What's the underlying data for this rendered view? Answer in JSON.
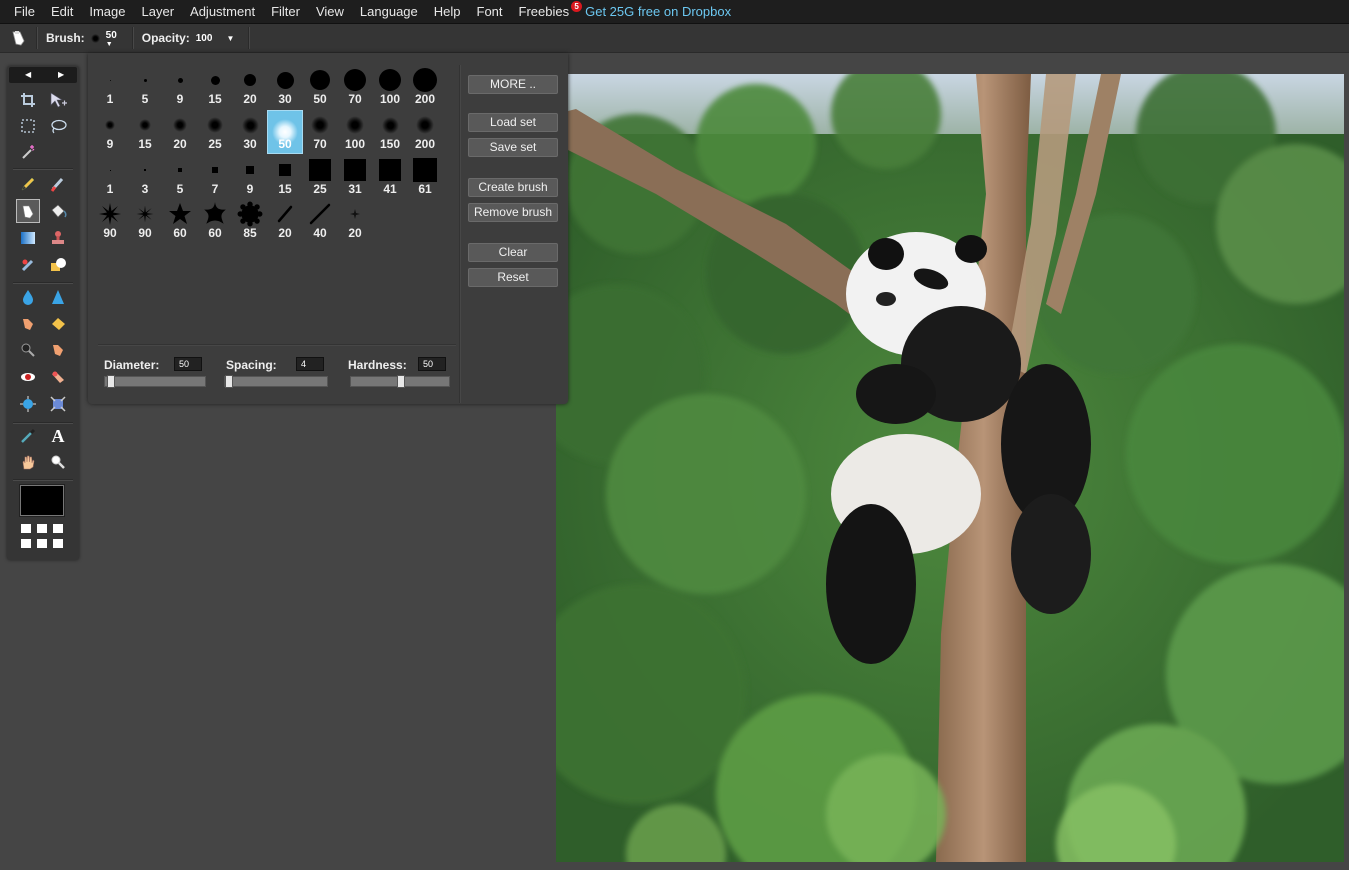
{
  "menu": {
    "items": [
      {
        "label": "File"
      },
      {
        "label": "Edit"
      },
      {
        "label": "Image"
      },
      {
        "label": "Layer"
      },
      {
        "label": "Adjustment"
      },
      {
        "label": "Filter"
      },
      {
        "label": "View"
      },
      {
        "label": "Language"
      },
      {
        "label": "Help"
      },
      {
        "label": "Font"
      },
      {
        "label": "Freebies",
        "badge": "5"
      }
    ],
    "promo": "Get 25G free on Dropbox"
  },
  "options": {
    "brush_label": "Brush:",
    "brush_size": "50",
    "opacity_label": "Opacity:",
    "opacity_value": "100"
  },
  "brush_panel": {
    "rows": [
      {
        "type": "round-hard",
        "items": [
          {
            "label": "1"
          },
          {
            "label": "5"
          },
          {
            "label": "9"
          },
          {
            "label": "15"
          },
          {
            "label": "20"
          },
          {
            "label": "30"
          },
          {
            "label": "50"
          },
          {
            "label": "70"
          },
          {
            "label": "100"
          },
          {
            "label": "200"
          }
        ]
      },
      {
        "type": "round-soft",
        "items": [
          {
            "label": "9"
          },
          {
            "label": "15"
          },
          {
            "label": "20"
          },
          {
            "label": "25"
          },
          {
            "label": "30"
          },
          {
            "label": "50",
            "selected": true
          },
          {
            "label": "70"
          },
          {
            "label": "100"
          },
          {
            "label": "150"
          },
          {
            "label": "200"
          }
        ]
      },
      {
        "type": "square",
        "items": [
          {
            "label": "1"
          },
          {
            "label": "3"
          },
          {
            "label": "5"
          },
          {
            "label": "7"
          },
          {
            "label": "9"
          },
          {
            "label": "15"
          },
          {
            "label": "25"
          },
          {
            "label": "31"
          },
          {
            "label": "41"
          },
          {
            "label": "61"
          }
        ]
      },
      {
        "type": "shape",
        "items": [
          {
            "label": "90"
          },
          {
            "label": "90"
          },
          {
            "label": "60"
          },
          {
            "label": "60"
          },
          {
            "label": "85"
          },
          {
            "label": "20"
          },
          {
            "label": "40"
          },
          {
            "label": "20"
          }
        ]
      }
    ],
    "buttons": {
      "more": "MORE ..",
      "load_set": "Load set",
      "save_set": "Save set",
      "create_brush": "Create brush",
      "remove_brush": "Remove brush",
      "clear": "Clear",
      "reset": "Reset"
    },
    "sliders": {
      "diameter": {
        "label": "Diameter:",
        "value": "50",
        "fraction": 0.02
      },
      "spacing": {
        "label": "Spacing:",
        "value": "4",
        "fraction": 0.0
      },
      "hardness": {
        "label": "Hardness:",
        "value": "50",
        "fraction": 0.5
      }
    }
  },
  "tools": [
    "crop-icon",
    "move-icon",
    "marquee-icon",
    "lasso-icon",
    "magic-wand-icon",
    "pencil-icon",
    "brush-icon",
    "clone-brush-icon",
    "paint-bucket-icon",
    "gradient-icon",
    "stamp-icon",
    "color-replace-icon",
    "shape-icon",
    "blur-icon",
    "sharpen-icon",
    "smudge-icon",
    "sponge-icon",
    "dodge-icon",
    "burn-icon",
    "red-eye-icon",
    "spot-heal-icon",
    "bloat-icon",
    "pinch-icon",
    "color-picker-icon",
    "type-icon",
    "hand-icon",
    "zoom-icon"
  ],
  "colors": {
    "accent": "#6fc3e8",
    "promo": "#6cc7f0",
    "foreground": "#000000"
  }
}
